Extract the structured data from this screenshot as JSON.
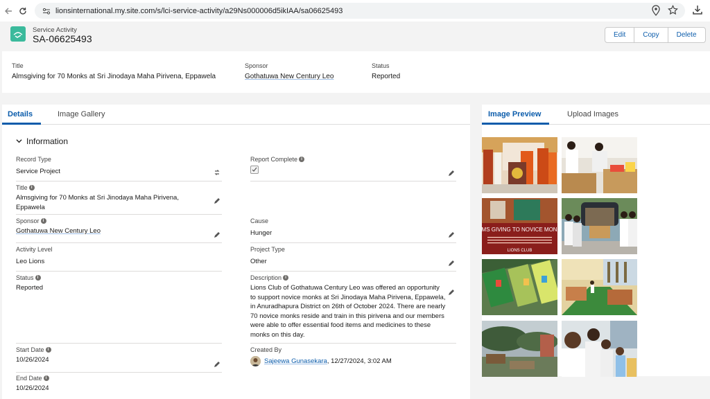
{
  "browser": {
    "url": "lionsinternational.my.site.com/s/lci-service-activity/a29Ns000006d5ikIAA/sa06625493"
  },
  "record": {
    "type_label": "Service Activity",
    "name": "SA-06625493",
    "actions": {
      "edit": "Edit",
      "copy": "Copy",
      "delete": "Delete"
    }
  },
  "highlights": {
    "title_label": "Title",
    "title_value": "Almsgiving for 70 Monks at Sri Jinodaya Maha Pirivena, Eppawela",
    "sponsor_label": "Sponsor",
    "sponsor_value": "Gothatuwa New Century Leo",
    "status_label": "Status",
    "status_value": "Reported"
  },
  "left_tabs": {
    "details": "Details",
    "gallery": "Image Gallery"
  },
  "section_title": "Information",
  "fields": {
    "record_type": {
      "label": "Record Type",
      "value": "Service Project"
    },
    "report_complete": {
      "label": "Report Complete",
      "checked": true
    },
    "title": {
      "label": "Title",
      "value": "Almsgiving for 70 Monks at Sri Jinodaya Maha Pirivena, Eppawela"
    },
    "sponsor": {
      "label": "Sponsor",
      "value": "Gothatuwa New Century Leo"
    },
    "cause": {
      "label": "Cause",
      "value": "Hunger"
    },
    "activity_level": {
      "label": "Activity Level",
      "value": "Leo Lions"
    },
    "project_type": {
      "label": "Project Type",
      "value": "Other"
    },
    "status": {
      "label": "Status",
      "value": "Reported"
    },
    "description": {
      "label": "Description",
      "value": "Lions Club of Gothatuwa Century Leo was offered an opportunity to support novice monks at Sri Jinodaya Maha Pirivena, Eppawela, in Anuradhapura District on 26th of October 2024. There are nearly 70 novice monks reside and train in this pirivena and our members were able to offer essential food items and medicines to these monks on this day."
    },
    "start_date": {
      "label": "Start Date",
      "value": "10/26/2024"
    },
    "created_by": {
      "label": "Created By",
      "user": "Sajeewa Gunasekara",
      "timestamp": ", 12/27/2024, 3:02 AM"
    },
    "end_date": {
      "label": "End Date",
      "value": "10/26/2024"
    }
  },
  "right_tabs": {
    "preview": "Image Preview",
    "upload": "Upload Images"
  },
  "gallery": {
    "poster_title": "ALMS GIVING TO NOVICE MONKS",
    "poster_club": "LIONS CLUB"
  },
  "colors": {
    "brand_link": "#0b5cab",
    "record_icon": "#3bba9c"
  }
}
